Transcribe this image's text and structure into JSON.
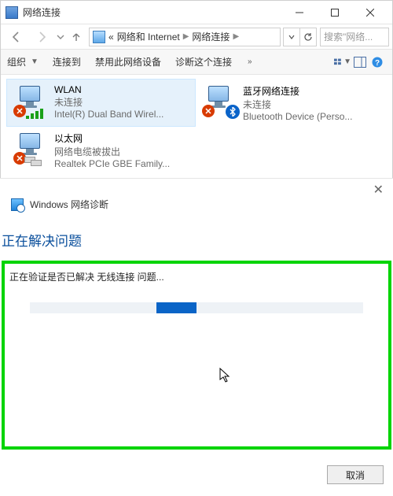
{
  "titlebar": {
    "title": "网络连接"
  },
  "breadcrumbs": {
    "prefix": "«",
    "item1": "网络和 Internet",
    "item2": "网络连接"
  },
  "search": {
    "placeholder": "搜索\"网络..."
  },
  "cmdbar": {
    "organize": "组织",
    "connect_to": "连接到",
    "disable_device": "禁用此网络设备",
    "diagnose": "诊断这个连接"
  },
  "connections": {
    "wlan": {
      "name": "WLAN",
      "state": "未连接",
      "device": "Intel(R) Dual Band Wirel..."
    },
    "bt": {
      "name": "蓝牙网络连接",
      "state": "未连接",
      "device": "Bluetooth Device (Perso..."
    },
    "eth": {
      "name": "以太网",
      "state": "网络电缆被拔出",
      "device": "Realtek PCIe GBE Family..."
    }
  },
  "troubleshooter": {
    "app_title": "Windows 网络诊断",
    "heading": "正在解决问题",
    "status": "正在验证是否已解决 无线连接 问题...",
    "cancel": "取消"
  }
}
